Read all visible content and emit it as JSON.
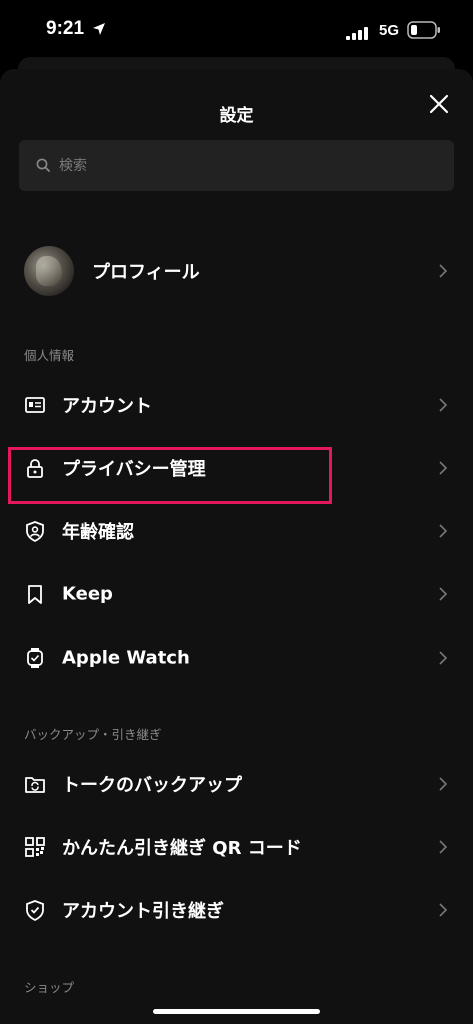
{
  "status": {
    "time": "9:21",
    "network": "5G"
  },
  "header": {
    "title": "設定"
  },
  "search": {
    "placeholder": "検索"
  },
  "profile": {
    "label": "プロフィール"
  },
  "sections": [
    {
      "title": "個人情報",
      "items": [
        {
          "label": "アカウント",
          "icon": "id-card-icon"
        },
        {
          "label": "プライバシー管理",
          "icon": "lock-icon"
        },
        {
          "label": "年齢確認",
          "icon": "shield-person-icon"
        },
        {
          "label": "Keep",
          "icon": "bookmark-icon"
        },
        {
          "label": "Apple Watch",
          "icon": "watch-icon"
        }
      ]
    },
    {
      "title": "バックアップ・引き継ぎ",
      "items": [
        {
          "label": "トークのバックアップ",
          "icon": "folder-sync-icon"
        },
        {
          "label": "かんたん引き継ぎ QR コード",
          "icon": "qr-code-icon"
        },
        {
          "label": "アカウント引き継ぎ",
          "icon": "shield-check-icon"
        }
      ]
    },
    {
      "title": "ショップ",
      "items": []
    }
  ],
  "highlight_color": "#e5185c"
}
